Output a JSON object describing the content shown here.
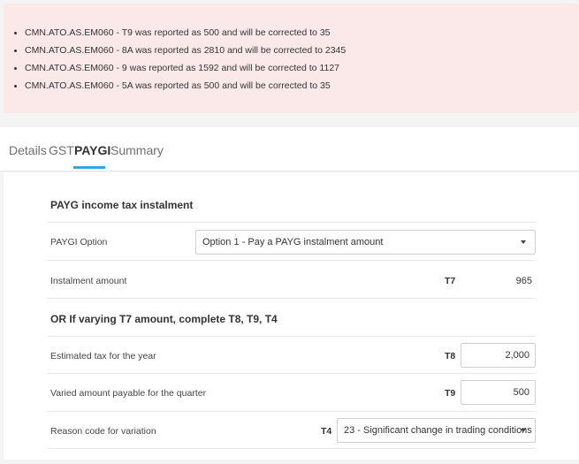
{
  "alerts": [
    "CMN.ATO.AS.EM060 - T9 was reported as 500 and will be corrected to 35",
    "CMN.ATO.AS.EM060 - 8A was reported as 2810 and will be corrected to 2345",
    "CMN.ATO.AS.EM060 - 9 was reported as 1592 and will be corrected to 1127",
    "CMN.ATO.AS.EM060 - 5A was reported as 500 and will be corrected to 35"
  ],
  "tabs": [
    {
      "label": "Details",
      "active": false
    },
    {
      "label": "GST",
      "active": false
    },
    {
      "label": "PAYGI",
      "active": true
    },
    {
      "label": "Summary",
      "active": false
    }
  ],
  "colors": {
    "accent": "#3aa3dc",
    "alert_bg": "#fbe9e9"
  },
  "form": {
    "section_title": "PAYG income tax instalment",
    "paygi_option": {
      "label": "PAYGI Option",
      "value": "Option 1 - Pay a PAYG instalment amount"
    },
    "instalment": {
      "label": "Instalment amount",
      "code": "T7",
      "value": "965"
    },
    "varying_title": "OR If varying T7 amount, complete T8, T9, T4",
    "estimated_tax": {
      "label": "Estimated tax for the year",
      "code": "T8",
      "value": "2,000"
    },
    "varied_amount": {
      "label": "Varied amount payable for the quarter",
      "code": "T9",
      "value": "500"
    },
    "reason_code": {
      "label": "Reason code for variation",
      "code": "T4",
      "value": "23 - Significant change in trading conditions"
    }
  }
}
